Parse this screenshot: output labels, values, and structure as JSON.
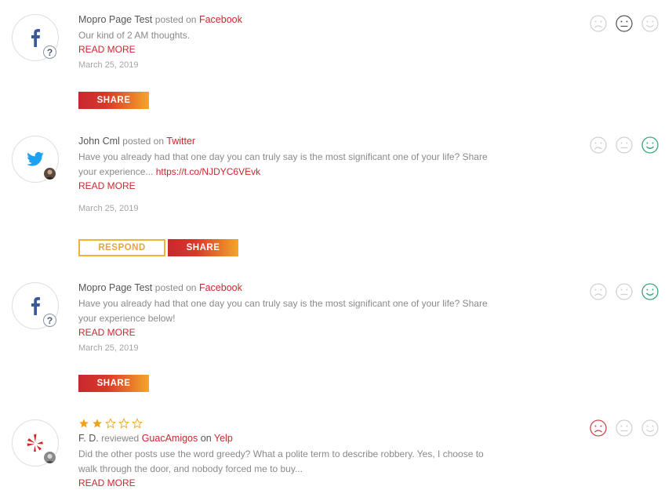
{
  "posts": [
    {
      "author": "Mopro Page Test",
      "verb": "posted on",
      "platform": "Facebook",
      "text": "Our kind of 2 AM thoughts.",
      "link": "",
      "read_more": "READ MORE",
      "date": "March 25, 2019",
      "share_label": "SHARE",
      "sentiment": "neutral"
    },
    {
      "author": "John Cml",
      "verb": "posted on",
      "platform": "Twitter",
      "text": "Have you already had that one day you can truly say is the most significant one of your life? Share your experience...",
      "link": "https://t.co/NJDYC6VEvk",
      "read_more": "READ MORE",
      "date": "March 25, 2019",
      "respond_label": "RESPOND",
      "share_label": "SHARE",
      "sentiment": "positive"
    },
    {
      "author": "Mopro Page Test",
      "verb": "posted on",
      "platform": "Facebook",
      "text": "Have you already had that one day you can truly say is the most significant one of your life? Share your experience below!",
      "link": "",
      "read_more": "READ MORE",
      "date": "March 25, 2019",
      "share_label": "SHARE",
      "sentiment": "positive"
    },
    {
      "rating": 2,
      "rating_max": 5,
      "author": "F. D.",
      "verb": "reviewed",
      "business": "GuacAmigos",
      "on": "on",
      "platform": "Yelp",
      "text": "Did the other posts use the word greedy? What a polite term to describe robbery. Yes, I choose to walk through the door, and nobody forced me to buy...",
      "read_more": "READ MORE",
      "sentiment": "negative"
    }
  ],
  "colors": {
    "accent": "#c8282e",
    "gradient_end": "#f3a62a",
    "respond": "#f0b23a",
    "positive": "#3aa57a",
    "neutral": "#555555",
    "negative": "#d4414a",
    "inactive": "#d0d0d0",
    "star": "#f0a21e",
    "facebook": "#3b5998",
    "twitter": "#1da1f2",
    "yelp": "#d32323"
  }
}
